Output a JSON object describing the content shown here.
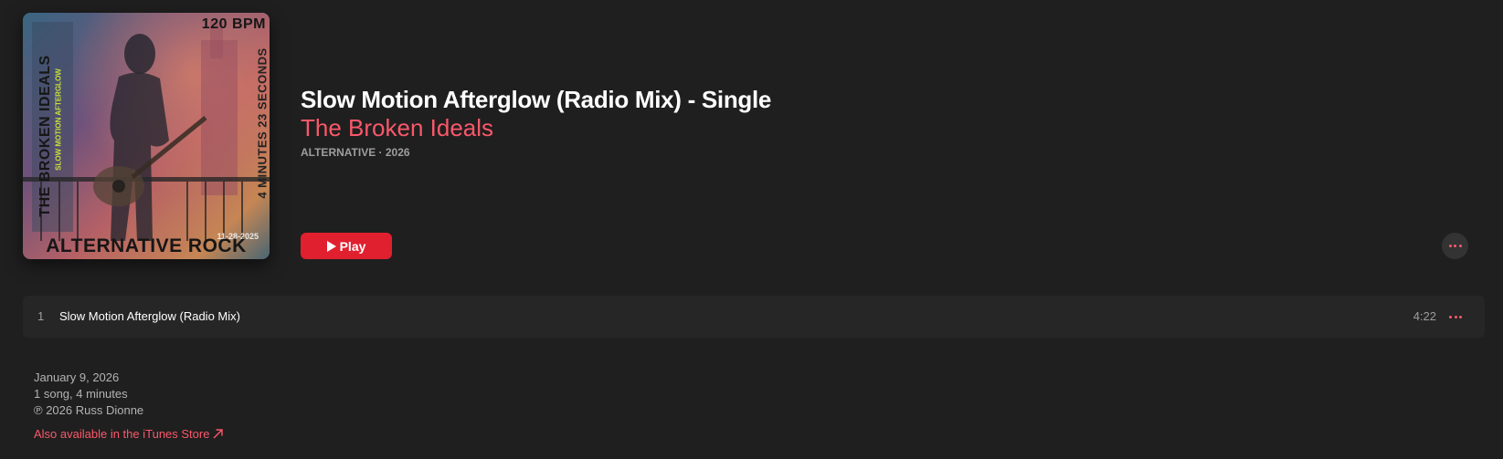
{
  "album": {
    "artwork": {
      "bpm_text": "120 BPM",
      "band_text": "THE BROKEN IDEALS",
      "song_text": "SLOW MOTION AFTERGLOW",
      "duration_text": "4 MINUTES 23 SECONDS",
      "date_text": "11-28-2025",
      "genre_text": "ALTERNATIVE ROCK"
    },
    "title": "Slow Motion Afterglow (Radio Mix) - Single",
    "artist": "The Broken Ideals",
    "meta": "ALTERNATIVE · 2026",
    "play_label": "Play",
    "more_icon": "ellipsis-icon"
  },
  "tracks": [
    {
      "number": "1",
      "title": "Slow Motion Afterglow (Radio Mix)",
      "duration": "4:22"
    }
  ],
  "footer": {
    "release_date": "January 9, 2026",
    "summary": "1 song, 4 minutes",
    "copyright": "℗ 2026 Russ Dionne",
    "store_link": "Also available in the iTunes Store"
  },
  "colors": {
    "background": "#1f1f1f",
    "accent": "#fa586a",
    "play_button": "#e0202f",
    "secondary_text": "#9e9e9e"
  }
}
